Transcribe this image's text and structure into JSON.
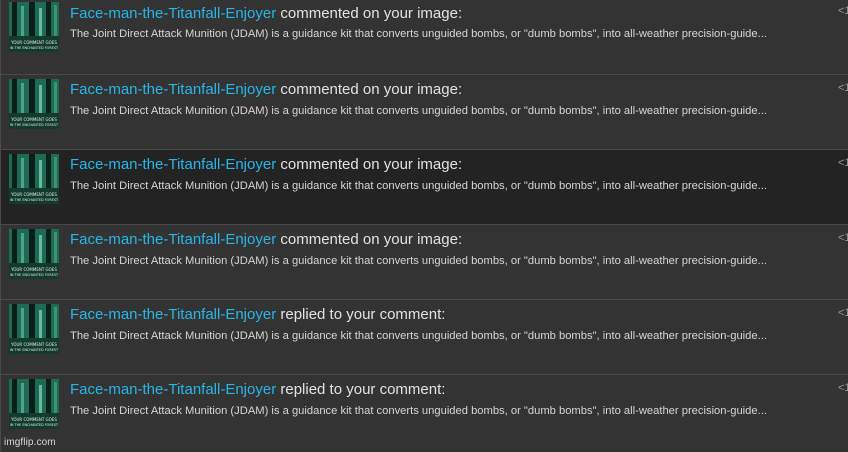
{
  "notifications": [
    {
      "user": "Face-man-the-Titanfall-Enjoyer",
      "action": "commented on your image:",
      "excerpt": "The Joint Direct Attack Munition (JDAM) is a guidance kit that converts unguided bombs, or \"dumb bombs\", into all-weather precision-guide...",
      "time": "<1",
      "highlighted": false
    },
    {
      "user": "Face-man-the-Titanfall-Enjoyer",
      "action": "commented on your image:",
      "excerpt": "The Joint Direct Attack Munition (JDAM) is a guidance kit that converts unguided bombs, or \"dumb bombs\", into all-weather precision-guide...",
      "time": "<1",
      "highlighted": false
    },
    {
      "user": "Face-man-the-Titanfall-Enjoyer",
      "action": "commented on your image:",
      "excerpt": "The Joint Direct Attack Munition (JDAM) is a guidance kit that converts unguided bombs, or \"dumb bombs\", into all-weather precision-guide...",
      "time": "<1",
      "highlighted": true
    },
    {
      "user": "Face-man-the-Titanfall-Enjoyer",
      "action": "commented on your image:",
      "excerpt": "The Joint Direct Attack Munition (JDAM) is a guidance kit that converts unguided bombs, or \"dumb bombs\", into all-weather precision-guide...",
      "time": "<1",
      "highlighted": false
    },
    {
      "user": "Face-man-the-Titanfall-Enjoyer",
      "action": "replied to your comment:",
      "excerpt": "The Joint Direct Attack Munition (JDAM) is a guidance kit that converts unguided bombs, or \"dumb bombs\", into all-weather precision-guide...",
      "time": "<1",
      "highlighted": false
    },
    {
      "user": "Face-man-the-Titanfall-Enjoyer",
      "action": "replied to your comment:",
      "excerpt": "The Joint Direct Attack Munition (JDAM) is a guidance kit that converts unguided bombs, or \"dumb bombs\", into all-weather precision-guide...",
      "time": "<1",
      "highlighted": false
    }
  ],
  "avatar": {
    "caption_line1": "YOUR COMMENT GOES",
    "caption_line2": "IN THE ENCHANTED FOREST"
  },
  "watermark": "imgflip.com",
  "colors": {
    "username": "#28b6e8",
    "row_background": "#333333",
    "row_highlight": "#232323",
    "avatar_forest": "#1d6b54"
  }
}
